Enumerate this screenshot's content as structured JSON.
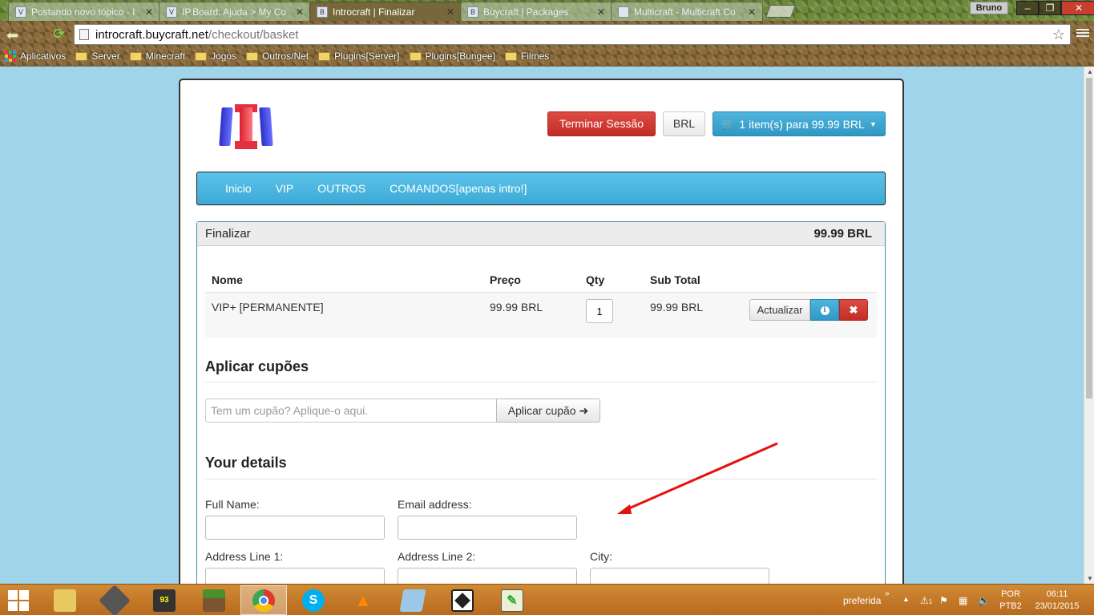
{
  "browser": {
    "tabs": [
      {
        "title": "Postando novo tópico - I",
        "active": false
      },
      {
        "title": "IP.Board: Ajuda > My Co",
        "active": false
      },
      {
        "title": "Introcraft | Finalizar",
        "active": true
      },
      {
        "title": "Buycraft | Packages",
        "active": false
      },
      {
        "title": "Multicraft - Multicraft Co",
        "active": false
      }
    ],
    "user": "Bruno",
    "url_host": "introcraft.buycraft.net",
    "url_path": "/checkout/basket",
    "bookmarks": [
      "Aplicativos",
      "Server",
      "Minecraft",
      "Jogos",
      "Outros/Net",
      "Plugins[Server]",
      "Plugins[Bungee]",
      "Filmes"
    ]
  },
  "header": {
    "logout_label": "Terminar Sessão",
    "currency_label": "BRL",
    "cart_label": "1 item(s) para 99.99 BRL"
  },
  "nav": [
    "Inicio",
    "VIP",
    "OUTROS",
    "COMANDOS[apenas intro!]"
  ],
  "checkout": {
    "title": "Finalizar",
    "total": "99.99 BRL",
    "columns": {
      "name": "Nome",
      "price": "Preço",
      "qty": "Qty",
      "subtotal": "Sub Total"
    },
    "items": [
      {
        "name": "VIP+ [PERMANENTE]",
        "price": "99.99 BRL",
        "qty": "1",
        "subtotal": "99.99 BRL"
      }
    ],
    "update_label": "Actualizar"
  },
  "coupon": {
    "heading": "Aplicar cupões",
    "placeholder": "Tem um cupão? Aplique-o aqui.",
    "button_label": "Aplicar cupão"
  },
  "details": {
    "heading": "Your details",
    "full_name_label": "Full Name:",
    "email_label": "Email address:",
    "address1_label": "Address Line 1:",
    "address2_label": "Address Line 2:",
    "city_label": "City:"
  },
  "annotation": {
    "arrow_color": "#e3120b"
  },
  "taskbar": {
    "tray_label": "preferida",
    "lang_top": "POR",
    "lang_bottom": "PTB2",
    "time": "06:11",
    "date": "23/01/2015",
    "notification_count": "1"
  },
  "colors": {
    "page_bg": "#a0d4ea",
    "danger": "#c9302c",
    "info": "#31a2d0"
  }
}
